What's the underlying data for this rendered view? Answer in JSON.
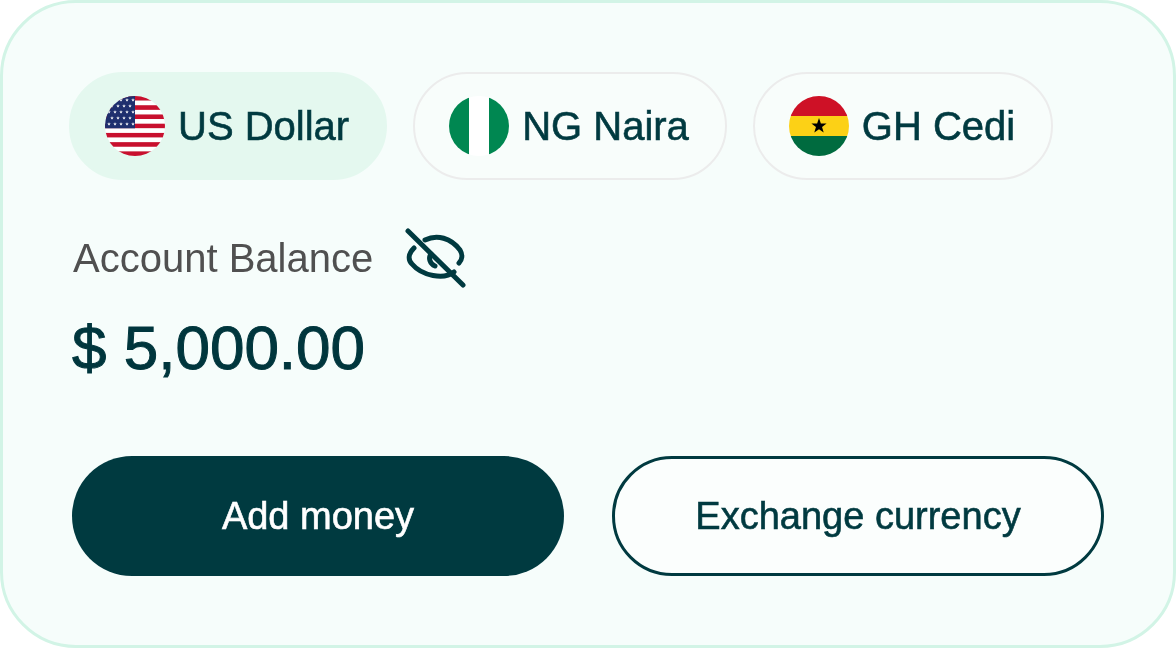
{
  "currencies": [
    {
      "label": "US Dollar",
      "kind": "us",
      "selected": true
    },
    {
      "label": "NG Naira",
      "kind": "ng",
      "selected": false
    },
    {
      "label": "GH Cedi",
      "kind": "gh",
      "selected": false
    }
  ],
  "balance": {
    "label": "Account Balance",
    "amount": "$ 5,000.00"
  },
  "buttons": [
    {
      "label": "Add money",
      "kind": "primary"
    },
    {
      "label": "Exchange currency",
      "kind": "outline"
    }
  ]
}
